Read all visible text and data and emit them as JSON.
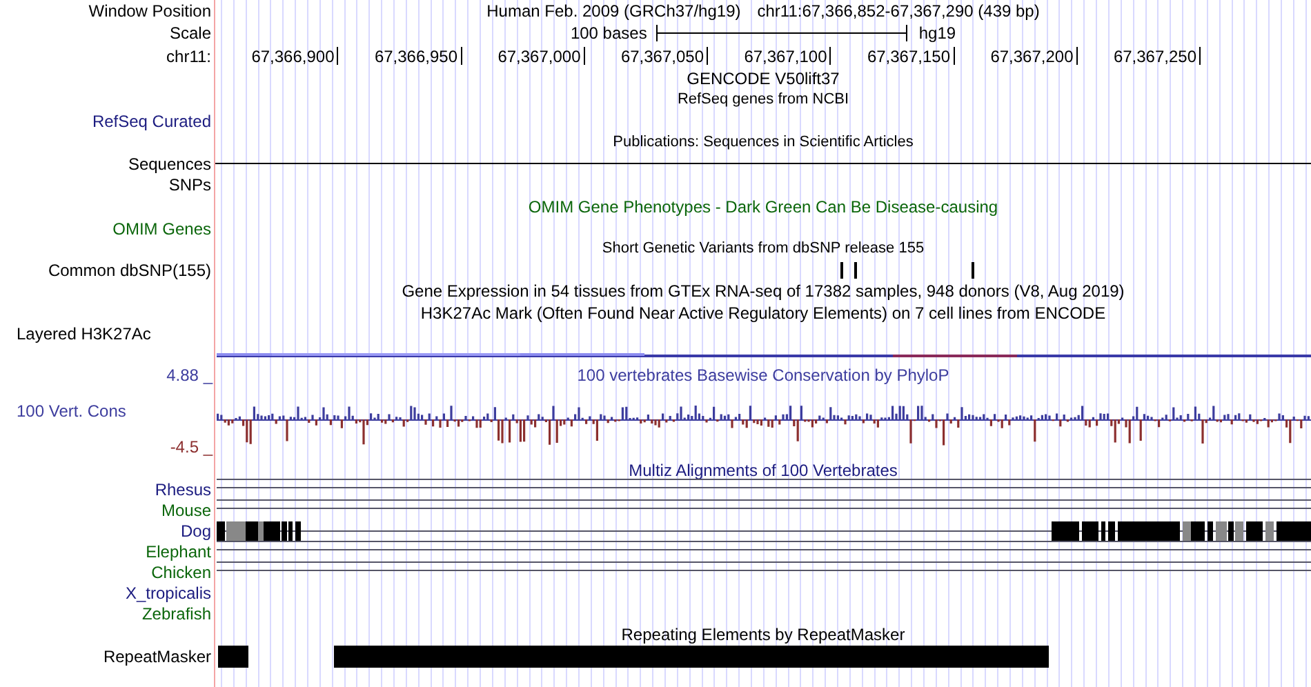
{
  "position": {
    "label": "Window Position",
    "assembly": "Human Feb. 2009 (GRCh37/hg19)",
    "range": "chr11:67,366,852-67,367,290 (439 bp)"
  },
  "scale": {
    "label": "Scale",
    "bases": "100 bases",
    "assembly": "hg19"
  },
  "ruler": {
    "label": "chr11:",
    "ticks": [
      "67,366,900",
      "67,366,950",
      "67,367,000",
      "67,367,050",
      "67,367,100",
      "67,367,150",
      "67,367,200",
      "67,367,250"
    ]
  },
  "tracks": [
    {
      "kind": "title",
      "text": "GENCODE V50lift37",
      "color": "#000000"
    },
    {
      "kind": "subtitle",
      "text": "RefSeq genes from NCBI",
      "color": "#000000"
    },
    {
      "kind": "label",
      "label": "RefSeq Curated",
      "color": "#1c1c80"
    },
    {
      "kind": "subtitle",
      "text": "Publications: Sequences in Scientific Articles",
      "color": "#000000"
    },
    {
      "kind": "sequence",
      "label": "Sequences",
      "color": "#000000"
    },
    {
      "kind": "label",
      "label": "SNPs",
      "color": "#000000"
    },
    {
      "kind": "title",
      "text": "OMIM Gene Phenotypes - Dark Green Can Be Disease-causing",
      "color": "#0b660b"
    },
    {
      "kind": "label",
      "label": "OMIM Genes",
      "color": "#0b660b"
    },
    {
      "kind": "subtitle",
      "text": "Short Genetic Variants from dbSNP release 155",
      "color": "#000000"
    },
    {
      "kind": "snp",
      "label": "Common dbSNP(155)",
      "color": "#000000"
    },
    {
      "kind": "title",
      "text": "Gene Expression in 54 tissues from GTEx RNA-seq of 17382 samples, 948 donors (V8, Aug 2019)",
      "color": "#000000"
    },
    {
      "kind": "title",
      "text": "H3K27Ac Mark (Often Found Near Active Regulatory Elements) on 7 cell lines from ENCODE",
      "color": "#000000"
    },
    {
      "kind": "layered",
      "label": "Layered H3K27Ac",
      "color": "#000000"
    },
    {
      "kind": "conservation",
      "title": {
        "text": "100 vertebrates Basewise Conservation by PhyloP",
        "color": "#3d3d9e"
      },
      "max": {
        "text": "4.88 _",
        "color": "#3d3d9e"
      },
      "label": {
        "text": "100 Vert. Cons",
        "color": "#3d3d9e"
      },
      "min": {
        "text": "-4.5 _",
        "color": "#8c2f2f"
      }
    },
    {
      "kind": "title",
      "text": "Multiz Alignments of 100 Vertebrates",
      "color": "#1c1c80"
    },
    {
      "kind": "aligned",
      "label": "Rhesus",
      "color": "#1c1c80"
    },
    {
      "kind": "aligned",
      "label": "Mouse",
      "color": "#0b660b"
    },
    {
      "kind": "blocks",
      "label": "Dog",
      "color": "#1c1c80"
    },
    {
      "kind": "aligned",
      "label": "Elephant",
      "color": "#0b660b"
    },
    {
      "kind": "aligned",
      "label": "Chicken",
      "color": "#0b660b"
    },
    {
      "kind": "unaligned",
      "label": "X_tropicalis",
      "color": "#1c1c80"
    },
    {
      "kind": "unaligned",
      "label": "Zebrafish",
      "color": "#0b660b"
    },
    {
      "kind": "title",
      "text": "Repeating Elements by RepeatMasker",
      "color": "#000000"
    },
    {
      "kind": "repeat",
      "label": "RepeatMasker",
      "color": "#000000"
    }
  ]
}
